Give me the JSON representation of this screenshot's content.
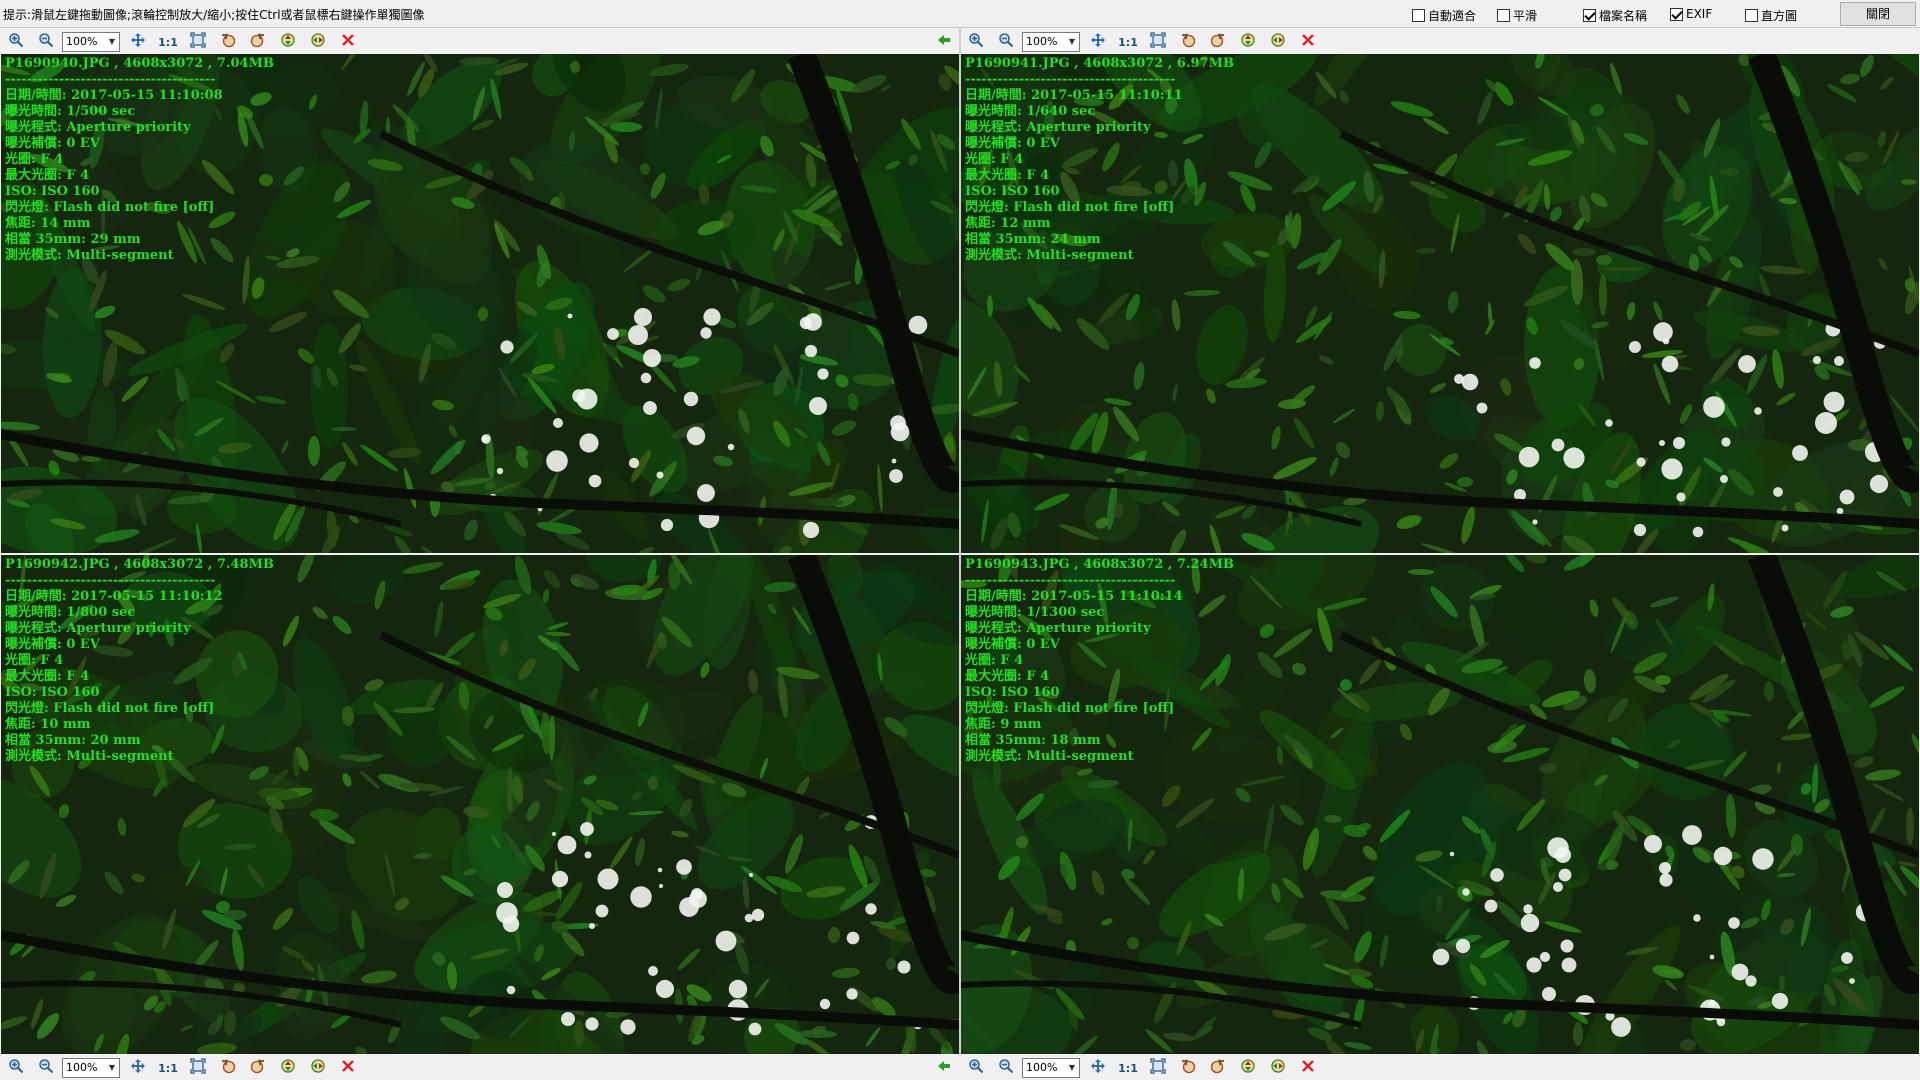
{
  "hint": "提示:滑鼠左鍵拖動圖像;滾輪控制放大/縮小;按住Ctrl或者鼠標右鍵操作單獨圖像",
  "options": [
    {
      "label": "自動適合",
      "checked": false
    },
    {
      "label": "平滑",
      "checked": false
    },
    {
      "label": "檔案名稱",
      "checked": true
    },
    {
      "label": "EXIF",
      "checked": true
    },
    {
      "label": "直方圖",
      "checked": false
    }
  ],
  "close_label": "關閉",
  "zoom_value": "100%",
  "one_to_one": "1:1",
  "colors": {
    "exif_text": "#22e01e",
    "close_x": "#e02020",
    "arrow": "#2a9d2a"
  },
  "panes": [
    {
      "file": "P1690940.JPG , 4608x3072 , 7.04MB",
      "separator": "---------------------------------------",
      "exif": [
        "日期/時間: 2017-05-15 11:10:08",
        "曝光時間: 1/500 sec",
        "曝光程式: Aperture priority",
        "曝光補償: 0 EV",
        "光圈: F 4",
        "最大光圈: F 4",
        "ISO: ISO 160",
        "閃光燈: Flash did not fire [off]",
        "焦距: 14 mm",
        "相當 35mm: 29 mm",
        "測光模式: Multi-segment"
      ]
    },
    {
      "file": "P1690941.JPG , 4608x3072 , 6.97MB",
      "separator": "---------------------------------------",
      "exif": [
        "日期/時間: 2017-05-15 11:10:11",
        "曝光時間: 1/640 sec",
        "曝光程式: Aperture priority",
        "曝光補償: 0 EV",
        "光圈: F 4",
        "最大光圈: F 4",
        "ISO: ISO 160",
        "閃光燈: Flash did not fire [off]",
        "焦距: 12 mm",
        "相當 35mm: 24 mm",
        "測光模式: Multi-segment"
      ]
    },
    {
      "file": "P1690942.JPG , 4608x3072 , 7.48MB",
      "separator": "---------------------------------------",
      "exif": [
        "日期/時間: 2017-05-15 11:10:12",
        "曝光時間: 1/800 sec",
        "曝光程式: Aperture priority",
        "曝光補償: 0 EV",
        "光圈: F 4",
        "最大光圈: F 4",
        "ISO: ISO 160",
        "閃光燈: Flash did not fire [off]",
        "焦距: 10 mm",
        "相當 35mm: 20 mm",
        "測光模式: Multi-segment"
      ]
    },
    {
      "file": "P1690943.JPG , 4608x3072 , 7.24MB",
      "separator": "---------------------------------------",
      "exif": [
        "日期/時間: 2017-05-15 11:10:14",
        "曝光時間: 1/1300 sec",
        "曝光程式: Aperture priority",
        "曝光補償: 0 EV",
        "光圈: F 4",
        "最大光圈: F 4",
        "ISO: ISO 160",
        "閃光燈: Flash did not fire [off]",
        "焦距: 9 mm",
        "相當 35mm: 18 mm",
        "測光模式: Multi-segment"
      ]
    }
  ]
}
